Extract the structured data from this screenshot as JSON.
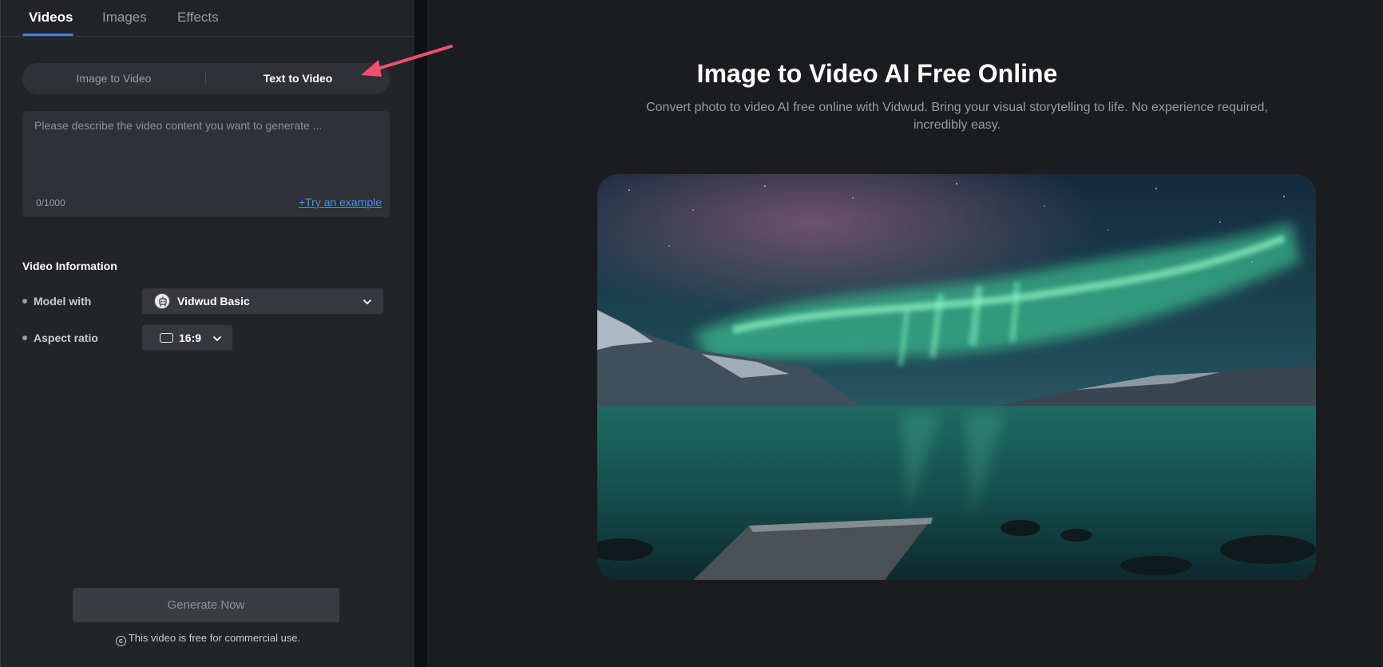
{
  "tabs": [
    {
      "label": "Videos",
      "active": true
    },
    {
      "label": "Images",
      "active": false
    },
    {
      "label": "Effects",
      "active": false
    }
  ],
  "mode_toggle": {
    "options": [
      "Image to Video",
      "Text to Video"
    ],
    "active": "Text to Video"
  },
  "prompt": {
    "placeholder": "Please describe the video content you want to generate ...",
    "value": "",
    "counter": "0/1000",
    "example_link": "+Try an example"
  },
  "video_info": {
    "title": "Video Information",
    "model": {
      "label": "Model with",
      "value": "Vidwud Basic"
    },
    "aspect": {
      "label": "Aspect ratio",
      "value": "16:9"
    }
  },
  "generate": {
    "label": "Generate Now"
  },
  "license_note": "This video is free for commercial use.",
  "main": {
    "title": "Image to Video AI Free Online",
    "subtitle": "Convert photo to video AI free online with Vidwud. Bring your visual storytelling to life. No experience required, incredibly easy."
  },
  "colors": {
    "accent": "#3f7fe0",
    "link": "#4a8fe6",
    "annotation_arrow": "#f0506e",
    "panel_bg": "#232428",
    "page_bg": "#1b1c1f"
  },
  "icons": {
    "model": "robot-avatar-icon",
    "chevron": "chevron-down-icon",
    "aspect": "landscape-rectangle-icon",
    "license": "copyright-icon"
  }
}
